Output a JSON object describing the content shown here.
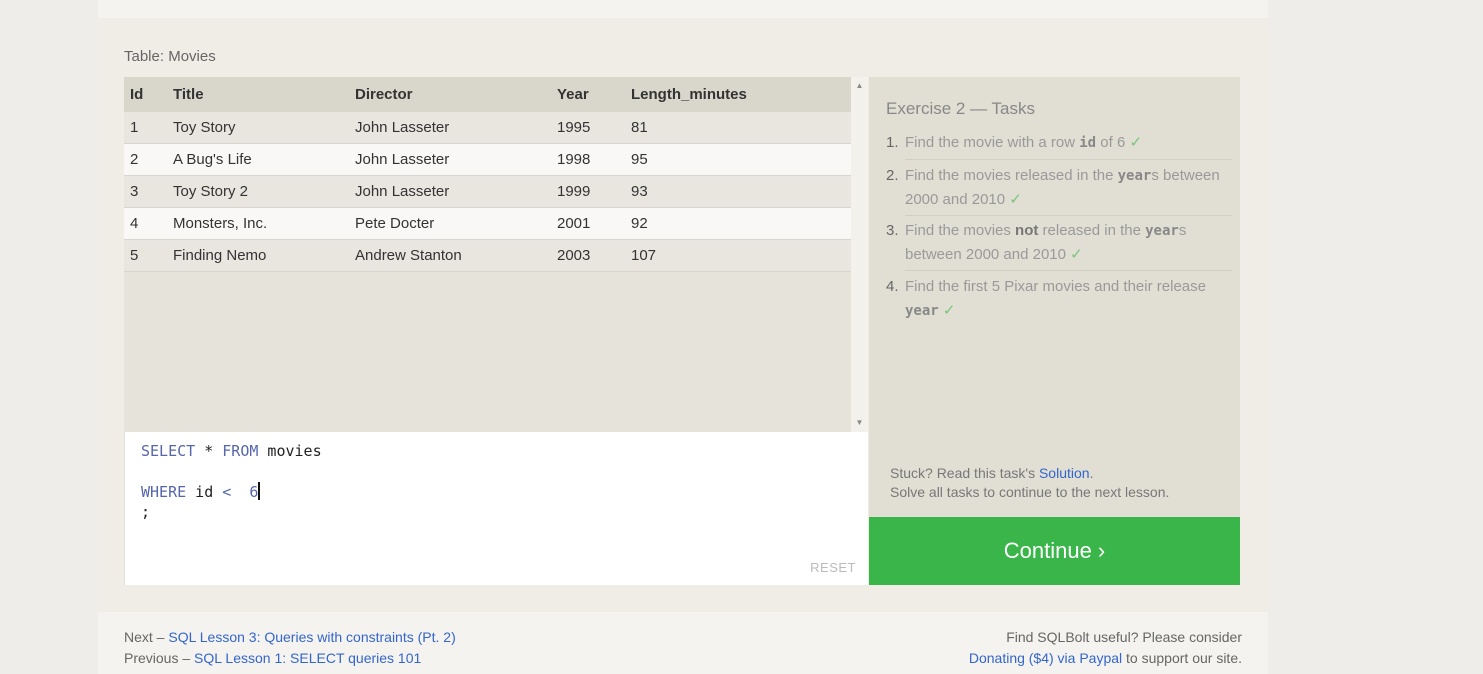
{
  "table": {
    "caption": "Table: Movies",
    "headers": [
      "Id",
      "Title",
      "Director",
      "Year",
      "Length_minutes"
    ],
    "rows": [
      [
        "1",
        "Toy Story",
        "John Lasseter",
        "1995",
        "81"
      ],
      [
        "2",
        "A Bug's Life",
        "John Lasseter",
        "1998",
        "95"
      ],
      [
        "3",
        "Toy Story 2",
        "John Lasseter",
        "1999",
        "93"
      ],
      [
        "4",
        "Monsters, Inc.",
        "Pete Docter",
        "2001",
        "92"
      ],
      [
        "5",
        "Finding Nemo",
        "Andrew Stanton",
        "2003",
        "107"
      ]
    ]
  },
  "editor": {
    "select_kw": "SELECT",
    "star": " * ",
    "from_kw": "FROM",
    "table_name": " movies",
    "where_kw": "WHERE",
    "where_col": " id ",
    "op": "<",
    "value": "  6",
    "terminator": ";",
    "reset_label": "RESET"
  },
  "tasks": {
    "title": "Exercise 2 — Tasks",
    "check": "✓",
    "items": [
      {
        "num": "1.",
        "pre": "Find the movie with a row ",
        "code": "id",
        "post": " of 6 "
      },
      {
        "num": "2.",
        "pre": "Find the movies released in the ",
        "code": "year",
        "post": "s between 2000 and 2010 "
      },
      {
        "num": "3.",
        "pre1": "Find the movies ",
        "bold": "not",
        "pre2": " released in the ",
        "code": "year",
        "post": "s between 2000 and 2010 "
      },
      {
        "num": "4.",
        "pre": "Find the first 5 Pixar movies and their release ",
        "code": "year",
        "post": " "
      }
    ],
    "stuck_pre": "Stuck? Read this task's ",
    "solution_link": "Solution",
    "stuck_post": ".",
    "solve_all": "Solve all tasks to continue to the next lesson."
  },
  "continue_label": "Continue ›",
  "footer": {
    "next_prefix": "Next – ",
    "next_link": "SQL Lesson 3: Queries with constraints (Pt. 2)",
    "prev_prefix": "Previous – ",
    "prev_link": "SQL Lesson 1: SELECT queries 101",
    "useful": "Find SQLBolt useful? Please consider",
    "donate_link": "Donating ($4) via Paypal",
    "donate_suffix": " to support our site."
  },
  "colors": {
    "accent_green": "#39b54a",
    "link_blue": "#3366cc",
    "check_green": "#7cc47c"
  }
}
